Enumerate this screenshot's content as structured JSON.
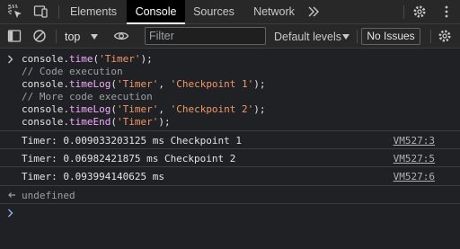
{
  "tabs": [
    {
      "label": "Elements"
    },
    {
      "label": "Console"
    },
    {
      "label": "Sources"
    },
    {
      "label": "Network"
    }
  ],
  "toolbar": {
    "context": "top",
    "filter_placeholder": "Filter",
    "levels": "Default levels",
    "issues": "No Issues"
  },
  "input": {
    "l1_a": "console.",
    "l1_fn": "time",
    "l1_b": "(",
    "l1_s": "'Timer'",
    "l1_c": ");",
    "l2": "// Code execution",
    "l3_a": "console.",
    "l3_fn": "timeLog",
    "l3_b": "(",
    "l3_s1": "'Timer'",
    "l3_m": ", ",
    "l3_s2": "'Checkpoint 1'",
    "l3_c": ");",
    "l4": "// More code execution",
    "l5_a": "console.",
    "l5_fn": "timeLog",
    "l5_b": "(",
    "l5_s1": "'Timer'",
    "l5_m": ", ",
    "l5_s2": "'Checkpoint 2'",
    "l5_c": ");",
    "l6_a": "console.",
    "l6_fn": "timeEnd",
    "l6_b": "(",
    "l6_s": "'Timer'",
    "l6_c": ");"
  },
  "logs": [
    {
      "text": "Timer: 0.009033203125 ms Checkpoint 1",
      "source": "VM527:3"
    },
    {
      "text": "Timer: 0.06982421875 ms Checkpoint 2",
      "source": "VM527:5"
    },
    {
      "text": "Timer: 0.093994140625 ms",
      "source": "VM527:6"
    }
  ],
  "result": "undefined"
}
